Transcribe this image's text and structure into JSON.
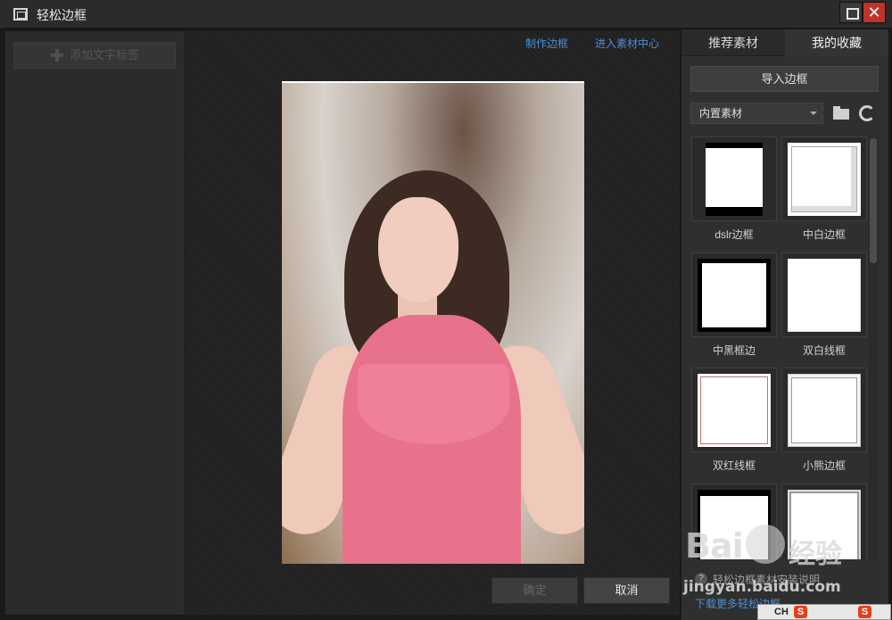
{
  "window": {
    "title": "轻松边框",
    "close_glyph": "✕"
  },
  "left_panel": {
    "add_text_label": "添加文字标签"
  },
  "center_panel": {
    "make_border_link": "制作边框",
    "material_center_link": "进入素材中心",
    "ok_label": "确定",
    "cancel_label": "取消"
  },
  "right_panel": {
    "tabs": [
      {
        "label": "推荐素材",
        "active": false
      },
      {
        "label": "我的收藏",
        "active": true
      }
    ],
    "import_label": "导入边框",
    "select_value": "内置素材",
    "frames": [
      {
        "caption": "dslr边框"
      },
      {
        "caption": "中白边框"
      },
      {
        "caption": "中黑框边"
      },
      {
        "caption": "双白线框"
      },
      {
        "caption": "双红线框"
      },
      {
        "caption": "小熊边框"
      },
      {
        "caption": ""
      },
      {
        "caption": ""
      }
    ],
    "help_text": "轻松边框素材安装说明",
    "download_link": "下载更多轻松边框"
  },
  "watermark": {
    "brand": "Bai",
    "brand_suffix": "经验",
    "url": "jingyan.baidu.com"
  },
  "ime": {
    "lang": "CH",
    "logo": "S"
  }
}
